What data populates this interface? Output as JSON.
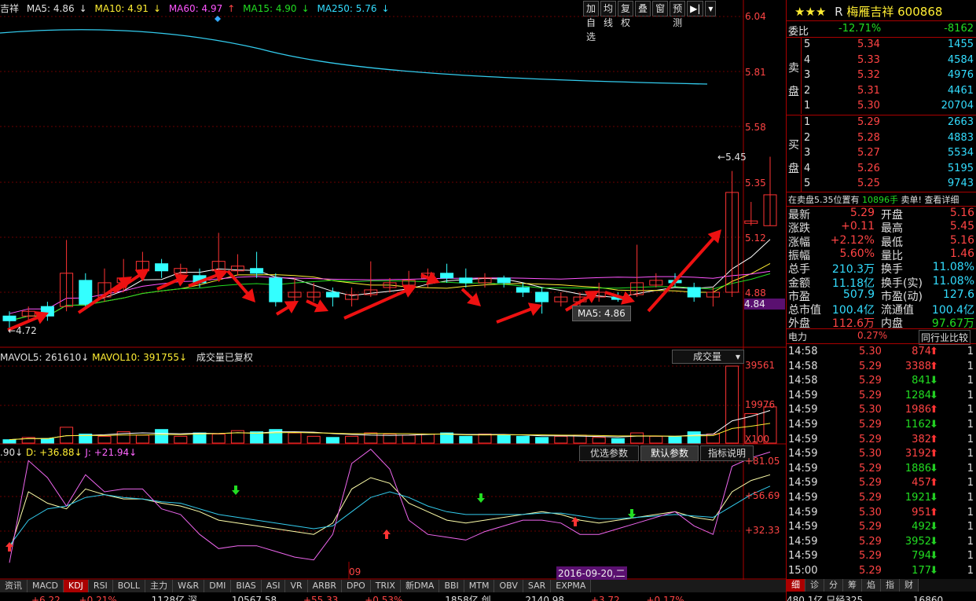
{
  "stock": {
    "rating": "★★★",
    "flag": "R",
    "name": "梅雁吉祥",
    "code": "600868"
  },
  "legend": {
    "name_fragment": "吉祥",
    "ma5": "MA5: 4.86",
    "ma10": "MA10: 4.91",
    "ma60": "MA60: 4.97",
    "ma15": "MA15: 4.90",
    "ma250": "MA250: 5.76"
  },
  "toolbar": [
    "加自选",
    "均线",
    "复权",
    "叠",
    "窗",
    "预测"
  ],
  "price_axis": [
    "6.04",
    "5.81",
    "5.58",
    "5.35",
    "5.12",
    "4.88",
    "4.84"
  ],
  "high_marker": "5.45",
  "low_marker": "4.72",
  "tooltip": "MA5: 4.86",
  "volume_legend": {
    "mavol5": "MAVOL5: 261610",
    "mavol10": "MAVOL10: 391755",
    "note": "成交量已复权",
    "selector": "成交量"
  },
  "volume_axis": [
    "39561",
    "19976",
    "X100"
  ],
  "kdj_legend": {
    "k": ".90",
    "d": "D: +36.88",
    "j": "J: +21.94"
  },
  "kdj_buttons": [
    "优选参数",
    "默认参数",
    "指标说明"
  ],
  "kdj_axis": [
    "+81.05",
    "+56.69",
    "+32.33"
  ],
  "date_labels": {
    "month": "09",
    "cursor_date": "2016-09-20,二"
  },
  "tabs": [
    "资讯",
    "MACD",
    "KDJ",
    "RSI",
    "BOLL",
    "主力",
    "W&R",
    "DMI",
    "BIAS",
    "ASI",
    "VR",
    "ARBR",
    "DPO",
    "TRIX",
    "新DMA",
    "BBI",
    "MTM",
    "OBV",
    "SAR",
    "EXPMA"
  ],
  "bottom_status": [
    "+6.22",
    "+0.21%",
    "1128亿",
    "深",
    "10567.58",
    "+55.33",
    "+0.53%",
    "1858亿",
    "创",
    "2140.98",
    "+3.72",
    "+0.17%"
  ],
  "order_book": {
    "weibi_label": "委比",
    "weibi": "-12.71%",
    "weicha": "-8162",
    "sell_label": [
      "卖",
      "盘"
    ],
    "buy_label": [
      "买",
      "盘"
    ],
    "sell": [
      {
        "lvl": "5",
        "price": "5.34",
        "vol": "1455"
      },
      {
        "lvl": "4",
        "price": "5.33",
        "vol": "4584"
      },
      {
        "lvl": "3",
        "price": "5.32",
        "vol": "4976"
      },
      {
        "lvl": "2",
        "price": "5.31",
        "vol": "4461"
      },
      {
        "lvl": "1",
        "price": "5.30",
        "vol": "20704"
      }
    ],
    "buy": [
      {
        "lvl": "1",
        "price": "5.29",
        "vol": "2663"
      },
      {
        "lvl": "2",
        "price": "5.28",
        "vol": "4883"
      },
      {
        "lvl": "3",
        "price": "5.27",
        "vol": "5534"
      },
      {
        "lvl": "4",
        "price": "5.26",
        "vol": "5195"
      },
      {
        "lvl": "5",
        "price": "5.25",
        "vol": "9743"
      }
    ],
    "notice": "在卖盘5.35位置有",
    "notice_vol": "10896手",
    "notice_action": "卖单!",
    "notice_link": "查看详细"
  },
  "quote": [
    {
      "l1": "最新",
      "v1": "5.29",
      "l2": "开盘",
      "v2": "5.16"
    },
    {
      "l1": "涨跌",
      "v1": "+0.11",
      "l2": "最高",
      "v2": "5.45"
    },
    {
      "l1": "涨幅",
      "v1": "+2.12%",
      "l2": "最低",
      "v2": "5.16"
    },
    {
      "l1": "振幅",
      "v1": "5.60%",
      "l2": "量比",
      "v2": "1.46"
    },
    {
      "l1": "总手",
      "v1": "210.3万",
      "l2": "换手",
      "v2": "11.08%"
    },
    {
      "l1": "金额",
      "v1": "11.18亿",
      "l2": "换手(实)",
      "v2": "11.08%"
    },
    {
      "l1": "市盈",
      "v1": "507.9",
      "l2": "市盈(动)",
      "v2": "127.6"
    },
    {
      "l1": "总市值",
      "v1": "100.4亿",
      "l2": "流通值",
      "v2": "100.4亿"
    },
    {
      "l1": "外盘",
      "v1": "112.6万",
      "l2": "内盘",
      "v2": "97.67万"
    }
  ],
  "industry": {
    "name": "电力",
    "pct": "0.27%",
    "compare": "同行业比较"
  },
  "ticks": [
    {
      "t": "14:58",
      "p": "5.30",
      "v": "874",
      "dir": "up"
    },
    {
      "t": "14:58",
      "p": "5.29",
      "v": "3388",
      "dir": "up"
    },
    {
      "t": "14:58",
      "p": "5.29",
      "v": "841",
      "dir": "down"
    },
    {
      "t": "14:59",
      "p": "5.29",
      "v": "1284",
      "dir": "down"
    },
    {
      "t": "14:59",
      "p": "5.30",
      "v": "1986",
      "dir": "up"
    },
    {
      "t": "14:59",
      "p": "5.29",
      "v": "1162",
      "dir": "down"
    },
    {
      "t": "14:59",
      "p": "5.29",
      "v": "382",
      "dir": "up"
    },
    {
      "t": "14:59",
      "p": "5.30",
      "v": "3192",
      "dir": "up"
    },
    {
      "t": "14:59",
      "p": "5.29",
      "v": "1886",
      "dir": "down"
    },
    {
      "t": "14:59",
      "p": "5.29",
      "v": "457",
      "dir": "up"
    },
    {
      "t": "14:59",
      "p": "5.29",
      "v": "1921",
      "dir": "down"
    },
    {
      "t": "14:59",
      "p": "5.30",
      "v": "951",
      "dir": "up"
    },
    {
      "t": "14:59",
      "p": "5.29",
      "v": "492",
      "dir": "down"
    },
    {
      "t": "14:59",
      "p": "5.29",
      "v": "3952",
      "dir": "down"
    },
    {
      "t": "14:59",
      "p": "5.29",
      "v": "794",
      "dir": "down"
    },
    {
      "t": "15:00",
      "p": "5.29",
      "v": "177",
      "dir": "down"
    }
  ],
  "tick_count_col": "1",
  "bottom_tabs": [
    "细",
    "诊",
    "分",
    "筹",
    "焰",
    "指",
    "财"
  ],
  "bottom_right": [
    "480.1亿",
    "只经325",
    "16860"
  ],
  "candles": [
    {
      "o": 4.78,
      "c": 4.76,
      "h": 4.8,
      "l": 4.72
    },
    {
      "o": 4.78,
      "c": 4.8,
      "h": 4.82,
      "l": 4.76
    },
    {
      "o": 4.82,
      "c": 4.78,
      "h": 4.84,
      "l": 4.76
    },
    {
      "o": 4.82,
      "c": 4.96,
      "h": 5.1,
      "l": 4.8
    },
    {
      "o": 4.93,
      "c": 4.83,
      "h": 4.96,
      "l": 4.81
    },
    {
      "o": 4.86,
      "c": 4.92,
      "h": 4.98,
      "l": 4.84
    },
    {
      "o": 4.92,
      "c": 4.94,
      "h": 5.02,
      "l": 4.88
    },
    {
      "o": 4.97,
      "c": 5.01,
      "h": 5.05,
      "l": 4.94
    },
    {
      "o": 5.0,
      "c": 4.97,
      "h": 5.02,
      "l": 4.94
    },
    {
      "o": 4.96,
      "c": 4.98,
      "h": 5.0,
      "l": 4.92
    },
    {
      "o": 4.95,
      "c": 4.92,
      "h": 4.98,
      "l": 4.9
    },
    {
      "o": 4.97,
      "c": 5.01,
      "h": 5.13,
      "l": 4.94
    },
    {
      "o": 4.97,
      "c": 4.99,
      "h": 5.04,
      "l": 4.95
    },
    {
      "o": 4.98,
      "c": 4.96,
      "h": 5.05,
      "l": 4.94
    },
    {
      "o": 4.94,
      "c": 4.84,
      "h": 4.96,
      "l": 4.82
    },
    {
      "o": 4.86,
      "c": 4.88,
      "h": 4.94,
      "l": 4.84
    },
    {
      "o": 4.86,
      "c": 4.88,
      "h": 4.92,
      "l": 4.84
    },
    {
      "o": 4.88,
      "c": 4.86,
      "h": 4.9,
      "l": 4.82
    },
    {
      "o": 4.85,
      "c": 4.87,
      "h": 4.9,
      "l": 4.82
    },
    {
      "o": 4.87,
      "c": 4.89,
      "h": 5.01,
      "l": 4.86
    },
    {
      "o": 4.9,
      "c": 4.92,
      "h": 4.94,
      "l": 4.88
    },
    {
      "o": 4.91,
      "c": 4.93,
      "h": 4.97,
      "l": 4.89
    },
    {
      "o": 4.94,
      "c": 4.96,
      "h": 4.98,
      "l": 4.9
    },
    {
      "o": 4.96,
      "c": 4.94,
      "h": 5.0,
      "l": 4.92
    },
    {
      "o": 4.94,
      "c": 4.92,
      "h": 4.98,
      "l": 4.9
    },
    {
      "o": 4.92,
      "c": 4.94,
      "h": 4.96,
      "l": 4.9
    },
    {
      "o": 4.94,
      "c": 4.92,
      "h": 4.95,
      "l": 4.9
    },
    {
      "o": 4.9,
      "c": 4.88,
      "h": 4.92,
      "l": 4.86
    },
    {
      "o": 4.88,
      "c": 4.84,
      "h": 4.9,
      "l": 4.79
    },
    {
      "o": 4.84,
      "c": 4.86,
      "h": 4.88,
      "l": 4.82
    },
    {
      "o": 4.84,
      "c": 4.86,
      "h": 4.88,
      "l": 4.82
    },
    {
      "o": 4.86,
      "c": 4.88,
      "h": 4.92,
      "l": 4.84
    },
    {
      "o": 4.86,
      "c": 4.85,
      "h": 4.88,
      "l": 4.84
    },
    {
      "o": 4.87,
      "c": 4.92,
      "h": 5.08,
      "l": 4.86
    },
    {
      "o": 4.91,
      "c": 4.93,
      "h": 4.96,
      "l": 4.9
    },
    {
      "o": 4.93,
      "c": 4.92,
      "h": 4.96,
      "l": 4.9
    },
    {
      "o": 4.9,
      "c": 4.86,
      "h": 4.92,
      "l": 4.84
    },
    {
      "o": 4.86,
      "c": 4.88,
      "h": 4.9,
      "l": 4.82
    },
    {
      "o": 4.88,
      "c": 5.3,
      "h": 5.39,
      "l": 4.86
    },
    {
      "o": 5.17,
      "c": 5.18,
      "h": 5.26,
      "l": 5.16
    },
    {
      "o": 5.16,
      "c": 5.29,
      "h": 5.45,
      "l": 5.16
    }
  ],
  "volumes": [
    3,
    5,
    4,
    14,
    8,
    6,
    10,
    7,
    12,
    6,
    9,
    8,
    11,
    10,
    12,
    9,
    6,
    5,
    6,
    9,
    8,
    7,
    8,
    9,
    6,
    8,
    7,
    6,
    5,
    6,
    7,
    5,
    4,
    9,
    6,
    6,
    10,
    8,
    68,
    26,
    32
  ],
  "kdj": {
    "k": [
      18,
      60,
      52,
      48,
      62,
      58,
      55,
      55,
      52,
      50,
      46,
      40,
      38,
      36,
      34,
      32,
      30,
      38,
      62,
      70,
      66,
      52,
      46,
      40,
      38,
      40,
      42,
      44,
      46,
      44,
      40,
      38,
      40,
      42,
      44,
      46,
      42,
      40,
      60,
      68,
      72
    ],
    "d": [
      22,
      40,
      48,
      50,
      56,
      58,
      56,
      55,
      53,
      52,
      48,
      44,
      42,
      40,
      38,
      36,
      34,
      36,
      46,
      56,
      60,
      56,
      50,
      46,
      44,
      44,
      44,
      44,
      45,
      45,
      43,
      41,
      41,
      42,
      43,
      44,
      43,
      42,
      50,
      58,
      64
    ],
    "j": [
      10,
      82,
      70,
      50,
      72,
      60,
      62,
      62,
      48,
      44,
      30,
      20,
      22,
      22,
      18,
      14,
      12,
      30,
      80,
      90,
      76,
      40,
      30,
      28,
      26,
      32,
      36,
      40,
      40,
      38,
      30,
      30,
      34,
      38,
      42,
      46,
      36,
      30,
      78,
      84,
      88
    ]
  }
}
